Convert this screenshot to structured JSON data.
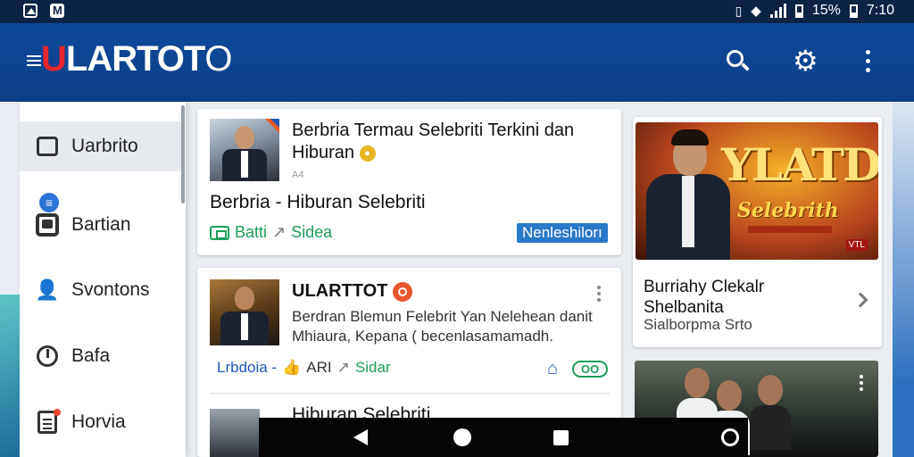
{
  "status_bar": {
    "battery": "15%",
    "time": "7:10"
  },
  "app_bar": {
    "brand_red": "U",
    "brand_rest": "LARTOT",
    "brand_thin": "O"
  },
  "drawer": {
    "items": [
      {
        "label": "Uarbrito",
        "icon": "chat-icon"
      },
      {
        "label": "Bartian",
        "icon": "box-icon"
      },
      {
        "label": "Svontons",
        "icon": "people-icon"
      },
      {
        "label": "Bafa",
        "icon": "clock-icon"
      },
      {
        "label": "Horvia",
        "icon": "document-icon"
      }
    ]
  },
  "feed": [
    {
      "title_line1": "Berbria Termau Selebriti Terkini dan",
      "title_line2": "Hiburan",
      "subtext": "A4",
      "headline": "Berbria  - Hiburan Selebriti",
      "meta_left": "Batti",
      "meta_right": "Sidea",
      "badge": "Nenleshilorı"
    },
    {
      "title": "ULARTTOT",
      "desc_line1": "Berdran Blemun Felebrit Yan Nelehean danit",
      "desc_line2": "Mhiaura, Kepana ( becenlasamamadh.",
      "meta_left": "Lrbdoia -",
      "meta_mid": "ARI",
      "meta_right": "Sidar",
      "pill": "OO"
    },
    {
      "title": "Hiburan Selebriti"
    }
  ],
  "promo": {
    "big_text": "YLATDO",
    "cursive": "Selebrith",
    "tag": "VTL",
    "title_line1": "Burriahy Clekalr",
    "title_line2": "Shelbanita",
    "subtitle": "Sialborpma Srto"
  },
  "colors": {
    "app_bar": "#0d4a9c",
    "status_bar": "#0c2344",
    "brand_red": "#e8262e",
    "accent_green": "#1e9e5a",
    "accent_blue": "#2979c9"
  }
}
